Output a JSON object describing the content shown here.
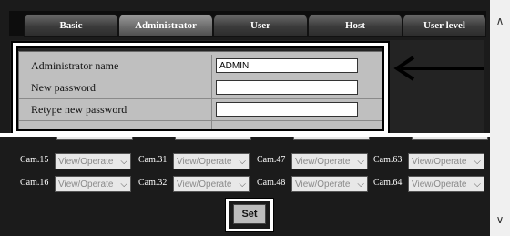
{
  "tabs": [
    {
      "label": "Basic",
      "active": false
    },
    {
      "label": "Administrator",
      "active": true
    },
    {
      "label": "User",
      "active": false
    },
    {
      "label": "Host",
      "active": false
    },
    {
      "label": "User level",
      "active": false
    }
  ],
  "settings": {
    "admin_name_label": "Administrator name",
    "admin_name_value": "ADMIN",
    "new_password_label": "New password",
    "new_password_value": "",
    "retype_password_label": "Retype new password",
    "retype_password_value": ""
  },
  "cameras": {
    "row1": [
      {
        "label": "Cam.15",
        "value": "View/Operate"
      },
      {
        "label": "Cam.31",
        "value": "View/Operate"
      },
      {
        "label": "Cam.47",
        "value": "View/Operate"
      },
      {
        "label": "Cam.63",
        "value": "View/Operate"
      }
    ],
    "row2": [
      {
        "label": "Cam.16",
        "value": "View/Operate"
      },
      {
        "label": "Cam.32",
        "value": "View/Operate"
      },
      {
        "label": "Cam.48",
        "value": "View/Operate"
      },
      {
        "label": "Cam.64",
        "value": "View/Operate"
      }
    ]
  },
  "set_label": "Set",
  "icons": {
    "arrow": "left-arrow-icon",
    "scroll_up": "chevron-up-icon",
    "scroll_down": "chevron-down-icon",
    "dropdown": "chevron-down-icon"
  }
}
